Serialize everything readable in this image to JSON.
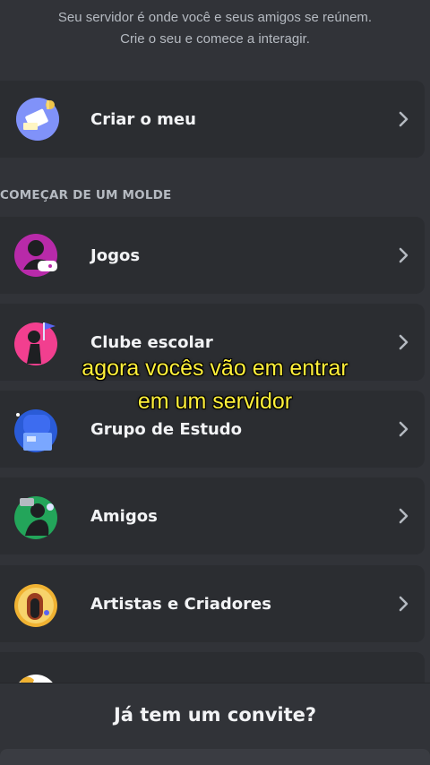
{
  "intro": {
    "line1": "Seu servidor é onde você e seus amigos se reúnem.",
    "line2": "Crie o seu e comece a interagir."
  },
  "create_own": {
    "label": "Criar o meu",
    "icon": "create-server-icon"
  },
  "template_section": {
    "title": "COMEÇAR DE UM MOLDE"
  },
  "templates": [
    {
      "label": "Jogos",
      "icon": "gaming-icon"
    },
    {
      "label": "Clube escolar",
      "icon": "school-club-icon"
    },
    {
      "label": "Grupo de Estudo",
      "icon": "study-group-icon"
    },
    {
      "label": "Amigos",
      "icon": "friends-icon"
    },
    {
      "label": "Artistas e Criadores",
      "icon": "artists-icon"
    },
    {
      "label": "",
      "icon": "local-community-icon"
    }
  ],
  "invite": {
    "label": "Já tem um convite?"
  },
  "caption": {
    "line1": "agora vocês vão em entrar",
    "line2": "em um servidor"
  },
  "colors": {
    "background": "#313338",
    "card": "#2b2d31",
    "caption": "#fff03a"
  }
}
